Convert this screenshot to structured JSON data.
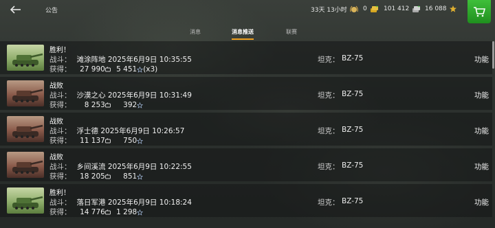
{
  "header": {
    "title": "公告",
    "timer": "33天 13小时",
    "gold": "0",
    "silver": "101 412",
    "free_xp": "16 088"
  },
  "tabs": [
    {
      "label": "消息",
      "active": false
    },
    {
      "label": "消息推送",
      "active": true
    },
    {
      "label": "联赛",
      "active": false
    }
  ],
  "messages": [
    {
      "result": "胜利！",
      "battle_label": "战斗：",
      "map": "滩涂阵地",
      "datetime": "2025年6月9日 10:35:55",
      "earn_label": "获得：",
      "credits": "27 990",
      "xp": "5 451",
      "xp_mult": "(x3)",
      "tank_label": "坦克：",
      "tank": "BZ-75",
      "action": "功能",
      "win": true
    },
    {
      "result": "战败",
      "battle_label": "战斗：",
      "map": "沙漠之心",
      "datetime": "2025年6月9日 10:31:49",
      "earn_label": "获得：",
      "credits": "8 253",
      "xp": "392",
      "xp_mult": "",
      "tank_label": "坦克：",
      "tank": "BZ-75",
      "action": "功能",
      "win": false
    },
    {
      "result": "战败",
      "battle_label": "战斗：",
      "map": "浮士德",
      "datetime": "2025年6月9日 10:26:57",
      "earn_label": "获得：",
      "credits": "11 137",
      "xp": "750",
      "xp_mult": "",
      "tank_label": "坦克：",
      "tank": "BZ-75",
      "action": "功能",
      "win": false
    },
    {
      "result": "战败",
      "battle_label": "战斗：",
      "map": "乡间溪流",
      "datetime": "2025年6月9日 10:22:55",
      "earn_label": "获得：",
      "credits": "18 205",
      "xp": "851",
      "xp_mult": "",
      "tank_label": "坦克：",
      "tank": "BZ-75",
      "action": "功能",
      "win": false
    },
    {
      "result": "胜利！",
      "battle_label": "战斗：",
      "map": "落日军港",
      "datetime": "2025年6月9日 10:18:24",
      "earn_label": "获得：",
      "credits": "14 776",
      "xp": "1 298",
      "xp_mult": "",
      "tank_label": "坦克：",
      "tank": "BZ-75",
      "action": "功能",
      "win": true
    }
  ],
  "icons": {
    "back": "back-arrow-icon",
    "premium": "premium-laurel-icon",
    "gold": "gold-coins-icon",
    "silver": "silver-coins-icon",
    "freexp": "free-xp-star-icon",
    "cart": "shopping-cart-icon"
  },
  "colors": {
    "accent": "#f0a020",
    "store": "#2ea82a"
  }
}
